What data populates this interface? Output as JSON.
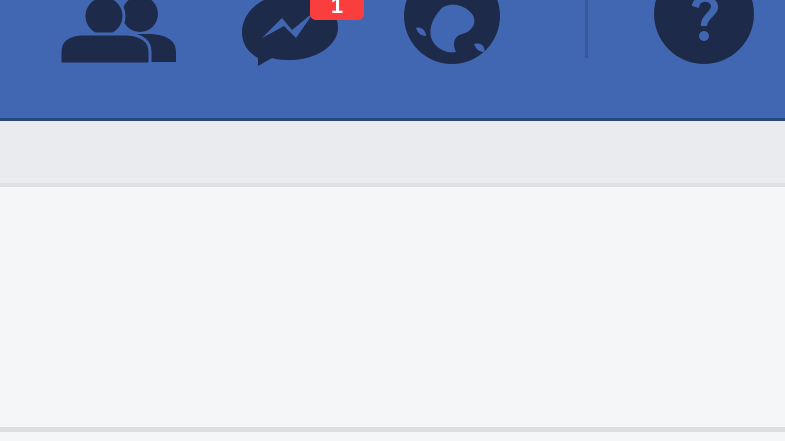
{
  "topbar": {
    "color": "#4267b2",
    "icons": [
      {
        "name": "friend-requests-icon"
      },
      {
        "name": "messenger-icon"
      },
      {
        "name": "notifications-globe-icon"
      },
      {
        "name": "help-icon"
      }
    ]
  },
  "messenger_badge": {
    "count": "1",
    "color": "#fa3e3e"
  },
  "colors": {
    "icon_dark": "#1d2a4a",
    "subbar": "#e9ebee",
    "content": "#f5f6f7"
  }
}
